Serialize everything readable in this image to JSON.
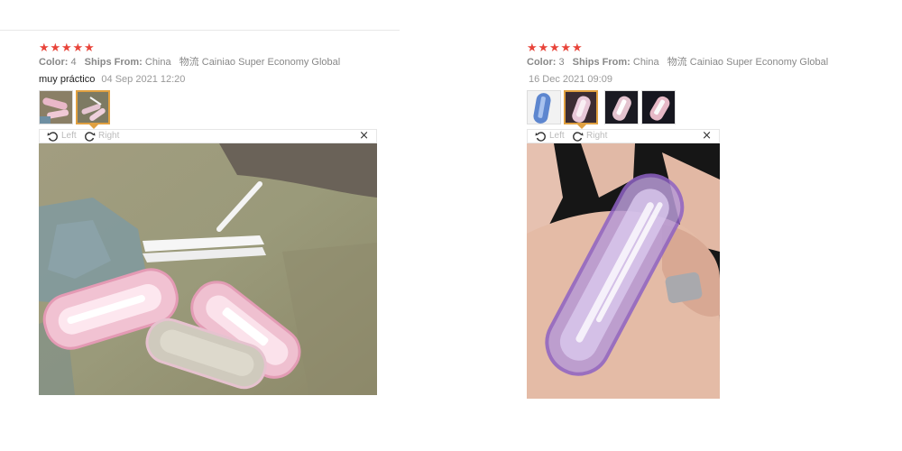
{
  "reviews": [
    {
      "stars": 5,
      "color_label": "Color:",
      "color_value": "4",
      "ships_label": "Ships From:",
      "ships_value": "China",
      "logistics_label": "物流",
      "logistics_value": "Cainiao Super Economy Global",
      "comment": "muy práctico",
      "date": "04 Sep 2021 12:20",
      "thumb_count": 2,
      "active_thumb": 1,
      "rotate_left": "Left",
      "rotate_right": "Right",
      "close": "×",
      "photo_icon": "product-photo-tweezers-cases"
    },
    {
      "stars": 5,
      "color_label": "Color:",
      "color_value": "3",
      "ships_label": "Ships From:",
      "ships_value": "China",
      "logistics_label": "物流",
      "logistics_value": "Cainiao Super Economy Global",
      "comment": "",
      "date": "16 Dec 2021 09:09",
      "thumb_count": 4,
      "active_thumb": 1,
      "rotate_left": "Left",
      "rotate_right": "Right",
      "close": "×",
      "photo_icon": "product-photo-purple-case-in-hand"
    }
  ],
  "colors": {
    "star": "#e8443a",
    "active_thumb_border": "#e0a040",
    "muted_text": "#888888"
  }
}
